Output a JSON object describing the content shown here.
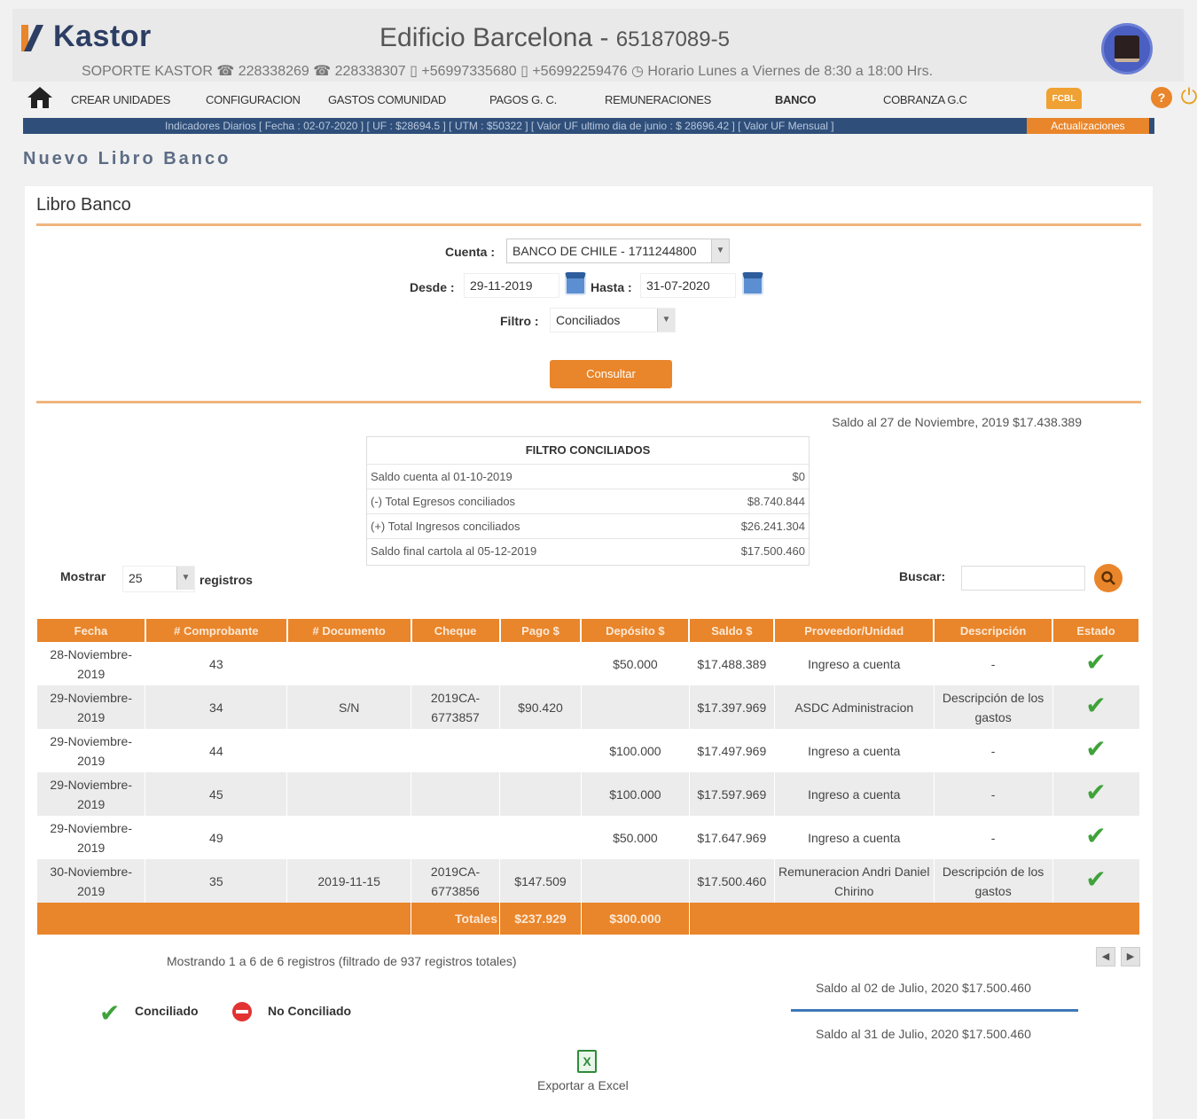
{
  "header": {
    "brand": "Kastor",
    "building": "Edificio Barcelona - ",
    "building_rut": "65187089-5",
    "support": "SOPORTE KASTOR  ☎ 228338269 ☎ 228338307 ▯ +56997335680 ▯ +56992259476  ◷ Horario Lunes a Viernes de 8:30 a 18:00 Hrs."
  },
  "nav": {
    "items": [
      "CREAR UNIDADES",
      "CONFIGURACION",
      "GASTOS COMUNIDAD",
      "PAGOS G. C.",
      "REMUNERACIONES",
      "BANCO",
      "COBRANZA G.C"
    ],
    "fcbl": "FCBL",
    "help": "?",
    "power": "⏻"
  },
  "indicators": {
    "text": "Indicadores Diarios [ Fecha : 02-07-2020 ] [ UF : $28694.5 ] [ UTM : $50322 ] [ Valor UF ultimo dia de junio : $ 28696.42 ] [ Valor UF Mensual ]",
    "update": "Actualizaciones"
  },
  "page": {
    "title": "Nuevo Libro Banco"
  },
  "panel": {
    "title": "Libro Banco"
  },
  "form": {
    "cuenta_label": "Cuenta :",
    "cuenta_value": "BANCO DE CHILE - 1711244800",
    "desde_label": "Desde :",
    "desde_value": "29-11-2019",
    "hasta_label": "Hasta :",
    "hasta_value": "31-07-2020",
    "filtro_label": "Filtro :",
    "filtro_value": "Conciliados",
    "consultar": "Consultar"
  },
  "saldo_top": "Saldo al 27 de Noviembre, 2019 $17.438.389",
  "filtro": {
    "title": "FILTRO CONCILIADOS",
    "rows": [
      {
        "label": "Saldo cuenta al 01-10-2019",
        "value": "$0"
      },
      {
        "label": "(-) Total Egresos conciliados",
        "value": "$8.740.844"
      },
      {
        "label": "(+) Total Ingresos conciliados",
        "value": "$26.241.304"
      },
      {
        "label": "Saldo final cartola al 05-12-2019",
        "value": "$17.500.460"
      }
    ]
  },
  "controls": {
    "mostrar": "Mostrar",
    "mostrar_value": "25",
    "registros": "registros",
    "buscar": "Buscar:"
  },
  "table": {
    "headers": [
      "Fecha",
      "# Comprobante",
      "# Documento",
      "Cheque",
      "Pago $",
      "Depósito $",
      "Saldo $",
      "Proveedor/Unidad",
      "Descripción",
      "Estado"
    ],
    "rows": [
      {
        "fecha": "28-Noviembre-2019",
        "comprobante": "43",
        "documento": "",
        "cheque": "",
        "pago": "",
        "deposito": "$50.000",
        "saldo": "$17.488.389",
        "proveedor": "Ingreso a cuenta",
        "descripcion": "-"
      },
      {
        "fecha": "29-Noviembre-2019",
        "comprobante": "34",
        "documento": "S/N",
        "cheque": "2019CA-6773857",
        "pago": "$90.420",
        "deposito": "",
        "saldo": "$17.397.969",
        "proveedor": "ASDC Administracion",
        "descripcion": "Descripción de los gastos"
      },
      {
        "fecha": "29-Noviembre-2019",
        "comprobante": "44",
        "documento": "",
        "cheque": "",
        "pago": "",
        "deposito": "$100.000",
        "saldo": "$17.497.969",
        "proveedor": "Ingreso a cuenta",
        "descripcion": "-"
      },
      {
        "fecha": "29-Noviembre-2019",
        "comprobante": "45",
        "documento": "",
        "cheque": "",
        "pago": "",
        "deposito": "$100.000",
        "saldo": "$17.597.969",
        "proveedor": "Ingreso a cuenta",
        "descripcion": "-"
      },
      {
        "fecha": "29-Noviembre-2019",
        "comprobante": "49",
        "documento": "",
        "cheque": "",
        "pago": "",
        "deposito": "$50.000",
        "saldo": "$17.647.969",
        "proveedor": "Ingreso a cuenta",
        "descripcion": "-"
      },
      {
        "fecha": "30-Noviembre-2019",
        "comprobante": "35",
        "documento": "2019-11-15",
        "cheque": "2019CA-6773856",
        "pago": "$147.509",
        "deposito": "",
        "saldo": "$17.500.460",
        "proveedor": "Remuneracion Andri Daniel Chirino",
        "descripcion": "Descripción de los gastos"
      }
    ],
    "totales_label": "Totales",
    "total_pago": "$237.929",
    "total_deposito": "$300.000"
  },
  "footer": {
    "showing": "Mostrando 1 a 6 de 6 registros (filtrado de 937 registros totales)",
    "saldo1": "Saldo al 02 de Julio, 2020 $17.500.460",
    "saldo2": "Saldo al 31 de Julio, 2020 $17.500.460",
    "legend_conciliado": "Conciliado",
    "legend_no": "No Conciliado",
    "export": "Exportar a Excel"
  },
  "colors": {
    "accent": "#e9852a",
    "navy": "#2d3e64",
    "check": "#3fa23a"
  }
}
